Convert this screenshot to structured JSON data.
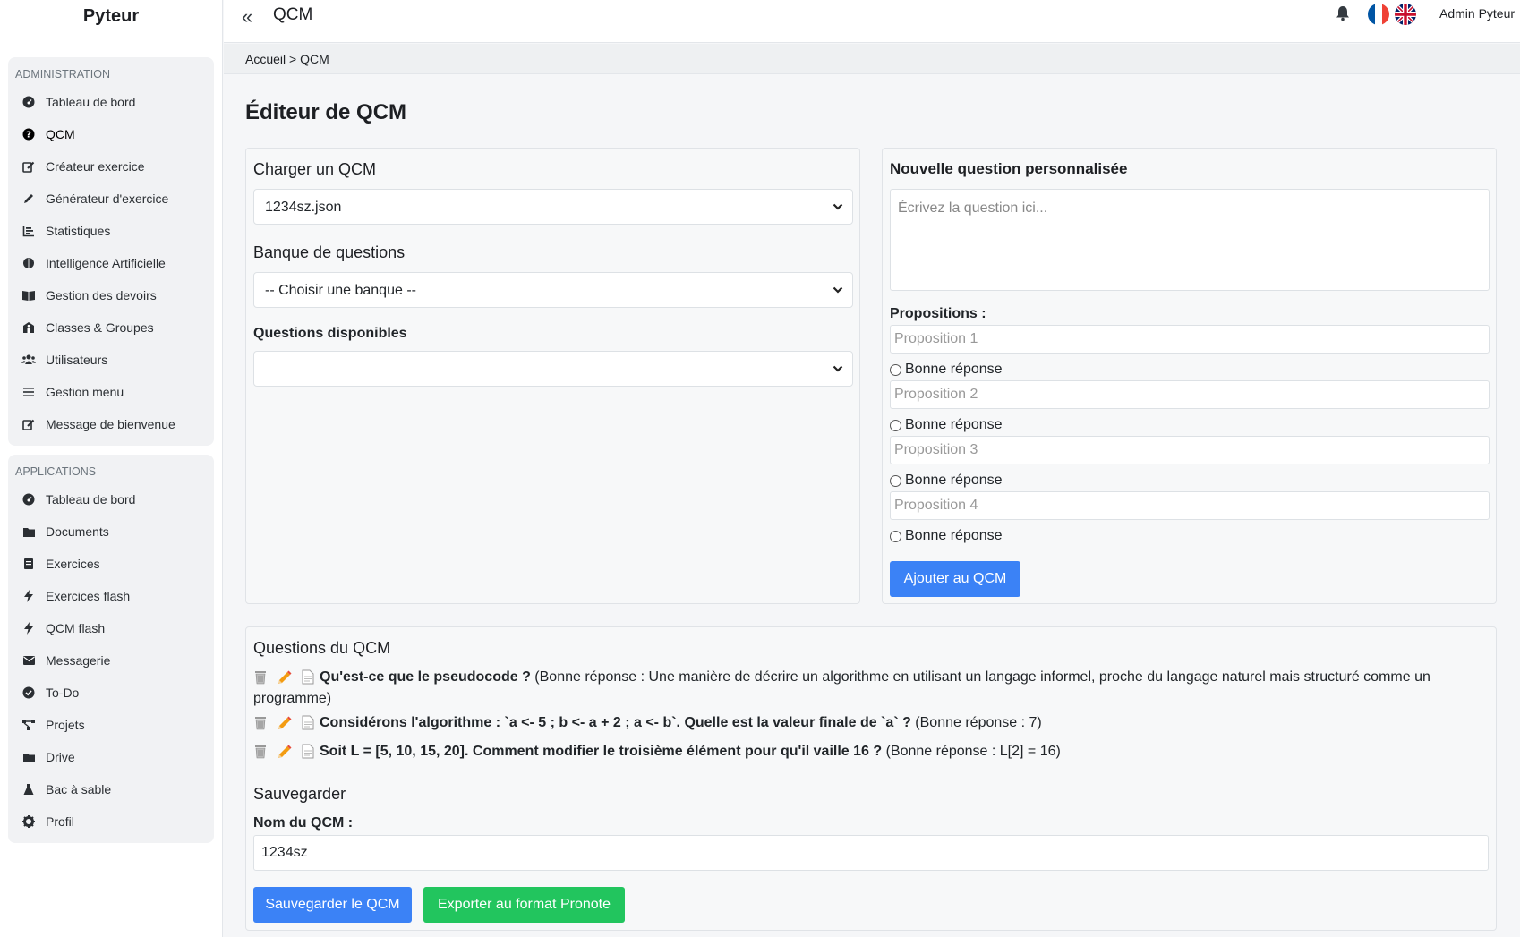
{
  "brand": "Pyteur",
  "topbar": {
    "page_name": "QCM",
    "user": "Admin Pyteur"
  },
  "breadcrumb": {
    "home": "Accueil",
    "sep": " > ",
    "current": "QCM"
  },
  "page_title": "Éditeur de QCM",
  "sidebar": {
    "admin_title": "ADMINISTRATION",
    "admin_items": [
      {
        "label": "Tableau de bord",
        "icon": "dashboard-icon"
      },
      {
        "label": "QCM",
        "icon": "question-circle-icon"
      },
      {
        "label": "Créateur exercice",
        "icon": "edit-icon"
      },
      {
        "label": "Générateur d'exercice",
        "icon": "pencil-icon"
      },
      {
        "label": "Statistiques",
        "icon": "chart-icon"
      },
      {
        "label": "Intelligence Artificielle",
        "icon": "brain-icon"
      },
      {
        "label": "Gestion des devoirs",
        "icon": "book-open-icon"
      },
      {
        "label": "Classes & Groupes",
        "icon": "school-icon"
      },
      {
        "label": "Utilisateurs",
        "icon": "users-icon"
      },
      {
        "label": "Gestion menu",
        "icon": "bars-icon"
      },
      {
        "label": "Message de bienvenue",
        "icon": "edit-icon"
      }
    ],
    "apps_title": "APPLICATIONS",
    "app_items": [
      {
        "label": "Tableau de bord",
        "icon": "dashboard-icon"
      },
      {
        "label": "Documents",
        "icon": "folder-icon"
      },
      {
        "label": "Exercices",
        "icon": "book-icon"
      },
      {
        "label": "Exercices flash",
        "icon": "bolt-icon"
      },
      {
        "label": "QCM flash",
        "icon": "bolt-icon"
      },
      {
        "label": "Messagerie",
        "icon": "envelope-icon"
      },
      {
        "label": "To-Do",
        "icon": "check-circle-icon"
      },
      {
        "label": "Projets",
        "icon": "project-diagram-icon"
      },
      {
        "label": "Drive",
        "icon": "folder-icon"
      },
      {
        "label": "Bac à sable",
        "icon": "flask-icon"
      },
      {
        "label": "Profil",
        "icon": "gear-icon"
      }
    ]
  },
  "load_card": {
    "title": "Charger un QCM",
    "qcm_select_value": "1234sz.json",
    "bank_title": "Banque de questions",
    "bank_select_value": "-- Choisir une banque --",
    "available_title": "Questions disponibles",
    "available_select_value": ""
  },
  "new_question": {
    "title": "Nouvelle question personnalisée",
    "placeholder": "Écrivez la question ici...",
    "propositions_label": "Propositions :",
    "propositions": [
      "Proposition 1",
      "Proposition 2",
      "Proposition 3",
      "Proposition 4"
    ],
    "correct_label": "Bonne réponse",
    "add_button": "Ajouter au QCM"
  },
  "qcm_questions": {
    "title": "Questions du QCM",
    "items": [
      {
        "question": "Qu'est-ce que le pseudocode ?",
        "answer": " (Bonne réponse : Une manière de décrire un algorithme en utilisant un langage informel, proche du langage naturel mais structuré comme un programme)"
      },
      {
        "question": "Considérons l'algorithme : `a <- 5 ; b <- a + 2 ; a <- b`. Quelle est la valeur finale de `a` ?",
        "answer": " (Bonne réponse : 7)"
      },
      {
        "question": "Soit L = [5, 10, 15, 20]. Comment modifier le troisième élément pour qu'il vaille 16 ?",
        "answer": " (Bonne réponse : L[2] = 16)"
      }
    ]
  },
  "save": {
    "title": "Sauvegarder",
    "name_label": "Nom du QCM :",
    "name_value": "1234sz",
    "save_button": "Sauvegarder le QCM",
    "export_button": "Exporter au format Pronote"
  },
  "colors": {
    "primary": "#3b82f6",
    "success": "#22c55e"
  }
}
